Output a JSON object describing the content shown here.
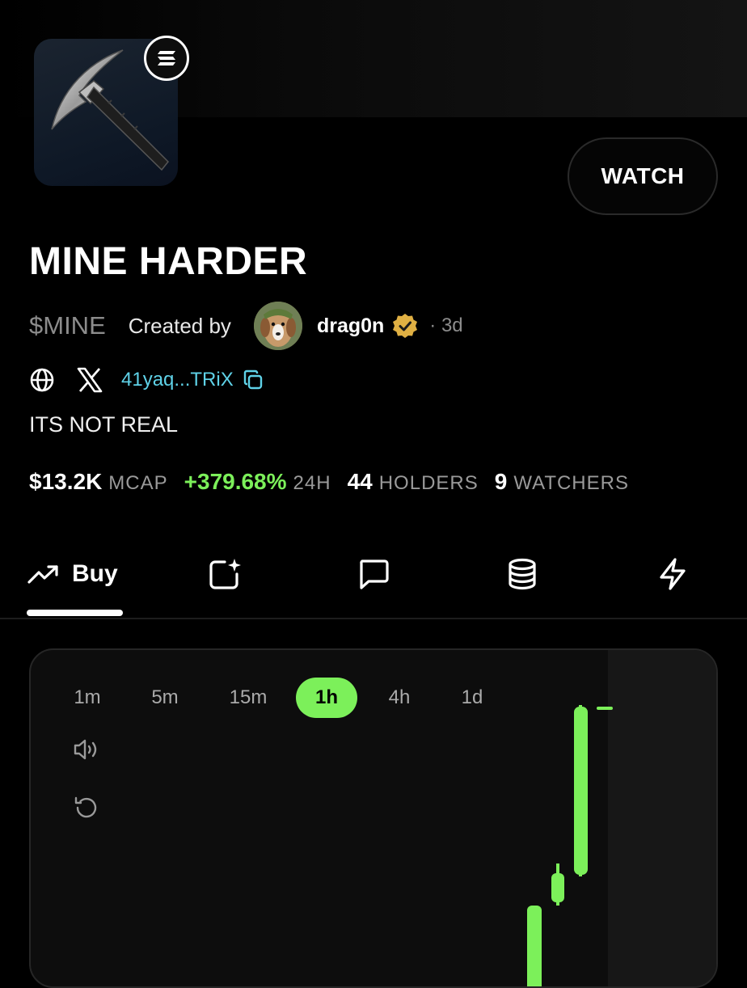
{
  "token": {
    "name": "MINE HARDER",
    "ticker": "$MINE",
    "description": "ITS NOT REAL",
    "address_short": "41yaq...TRiX",
    "chain_icon": "solana-icon",
    "image_icon": "pickaxe-icon"
  },
  "watch_label": "WATCH",
  "creator": {
    "created_by_label": "Created by",
    "name": "drag0n",
    "age": "· 3d",
    "verified_icon": "verified-badge-icon"
  },
  "stats": {
    "mcap_value": "$13.2K",
    "mcap_label": "MCAP",
    "change_value": "+379.68%",
    "change_label": "24H",
    "holders_value": "44",
    "holders_label": "HOLDERS",
    "watchers_value": "9",
    "watchers_label": "WATCHERS"
  },
  "tabs": [
    {
      "label": "Buy",
      "icon": "trending-up-icon",
      "active": true
    },
    {
      "label": "",
      "icon": "sparkle-image-icon"
    },
    {
      "label": "",
      "icon": "chat-icon"
    },
    {
      "label": "",
      "icon": "coins-stack-icon"
    },
    {
      "label": "",
      "icon": "lightning-icon"
    }
  ],
  "chart": {
    "timeframes": [
      "1m",
      "5m",
      "15m",
      "1h",
      "4h",
      "1d"
    ],
    "active_timeframe": "1h",
    "tools": [
      "sound-icon",
      "reset-icon"
    ]
  },
  "colors": {
    "accent_green": "#7cf05a",
    "address_cyan": "#5fd2e8",
    "muted": "#8c8c8c"
  }
}
